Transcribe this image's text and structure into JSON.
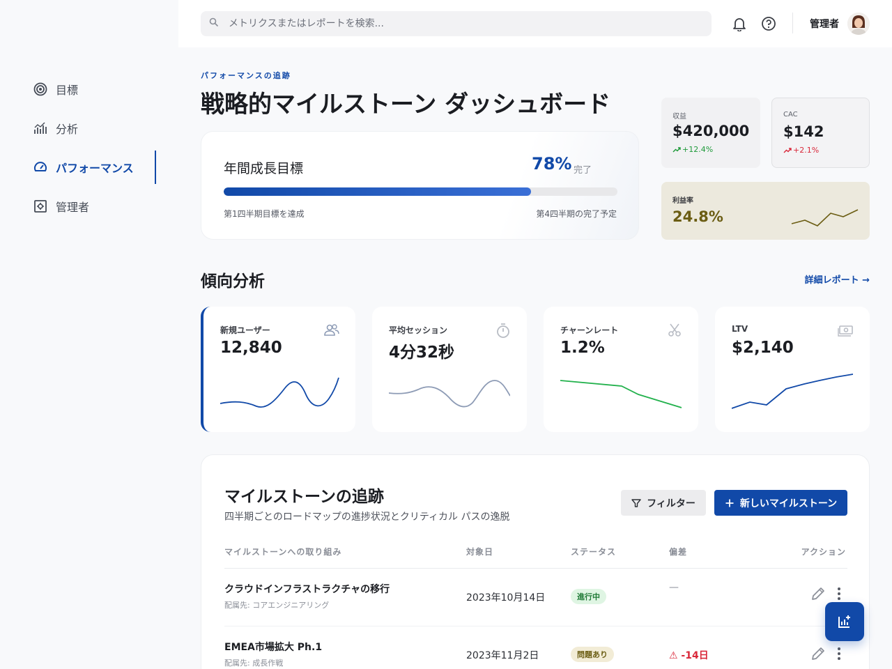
{
  "colors": {
    "primary": "#1149a8",
    "positive": "#1f9a3a",
    "negative": "#d9283a",
    "gold": "#6b5d13"
  },
  "header": {
    "search_placeholder": "メトリクスまたはレポートを検索...",
    "notifications_icon": "bell-icon",
    "help_icon": "help-circle-icon",
    "user_name": "管理者"
  },
  "sidebar": {
    "items": [
      {
        "label": "目標",
        "icon": "target-icon"
      },
      {
        "label": "分析",
        "icon": "bar-chart-icon"
      },
      {
        "label": "パフォーマンス",
        "icon": "speedometer-icon",
        "active": true
      },
      {
        "label": "管理者",
        "icon": "admin-settings-icon"
      }
    ]
  },
  "page": {
    "eyebrow": "パフォーマンスの追跡",
    "title": "戦略的マイルストーン ダッシュボード"
  },
  "growth": {
    "title": "年間成長目標",
    "percent_label": "78%",
    "percent": 78,
    "done_label": "完了",
    "left_note": "第1四半期目標を達成",
    "right_note": "第4四半期の完了予定"
  },
  "kpis": {
    "revenue": {
      "label": "収益",
      "value": "$420,000",
      "delta": "+12.4%"
    },
    "cac": {
      "label": "CAC",
      "value": "$142",
      "delta": "+2.1%"
    },
    "margin": {
      "label": "利益率",
      "value": "24.8%"
    }
  },
  "trends": {
    "title": "傾向分析",
    "detail_link": "詳細レポート →",
    "cards": [
      {
        "label": "新規ユーザー",
        "value": "12,840",
        "icon": "users-icon",
        "color": "#1149a8"
      },
      {
        "label": "平均セッション",
        "value": "4分32秒",
        "icon": "stopwatch-icon",
        "color": "#8d9bb5"
      },
      {
        "label": "チャーンレート",
        "value": "1.2%",
        "icon": "scissors-icon",
        "color": "#22b14c"
      },
      {
        "label": "LTV",
        "value": "$2,140",
        "icon": "money-icon",
        "color": "#1149a8"
      }
    ]
  },
  "milestones": {
    "title": "マイルストーンの追跡",
    "subtitle": "四半期ごとのロードマップの進捗状況とクリティカル パスの逸脱",
    "filter_label": "フィルター",
    "new_label": "新しいマイルストーン",
    "columns": {
      "initiative": "マイルストーンへの取り組み",
      "date": "対象日",
      "status": "ステータス",
      "deviation": "偏差",
      "actions": "アクション"
    },
    "rows": [
      {
        "name": "クラウドインフラストラクチャの移行",
        "owner": "配属先: コアエンジニアリング",
        "date": "2023年10月14日",
        "status": "進行中",
        "deviation": "—"
      },
      {
        "name": "EMEA市場拡大 Ph.1",
        "owner": "配属先: 成長作戦",
        "date": "2023年11月2日",
        "status": "問題あり",
        "deviation": "⚠ -14日"
      }
    ]
  }
}
